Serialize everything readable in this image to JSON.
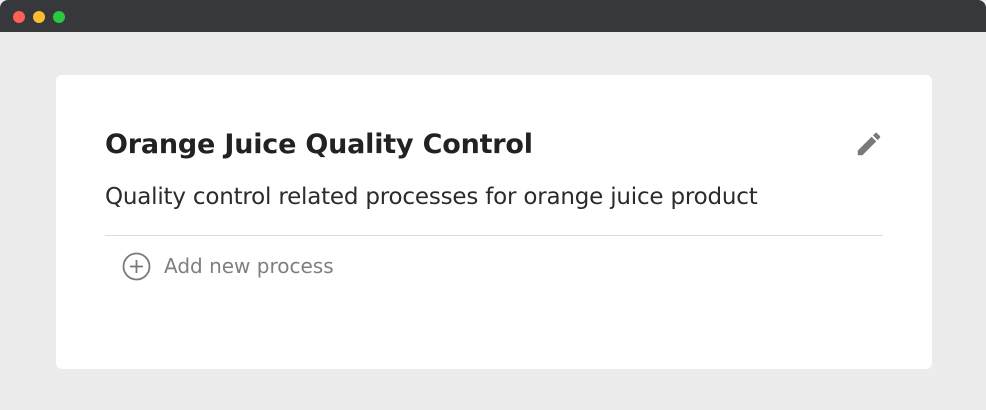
{
  "card": {
    "title": "Orange Juice Quality Control",
    "description": "Quality control related processes for orange juice product",
    "add_process_label": "Add new process"
  },
  "icons": {
    "edit": "pencil-icon",
    "add": "plus-circle-icon"
  },
  "colors": {
    "titlebar": "#37383b",
    "close_dot": "#fe5f57",
    "minimize_dot": "#febc2e",
    "maximize_dot": "#28c840",
    "icon_gray": "#7a7a7a"
  }
}
